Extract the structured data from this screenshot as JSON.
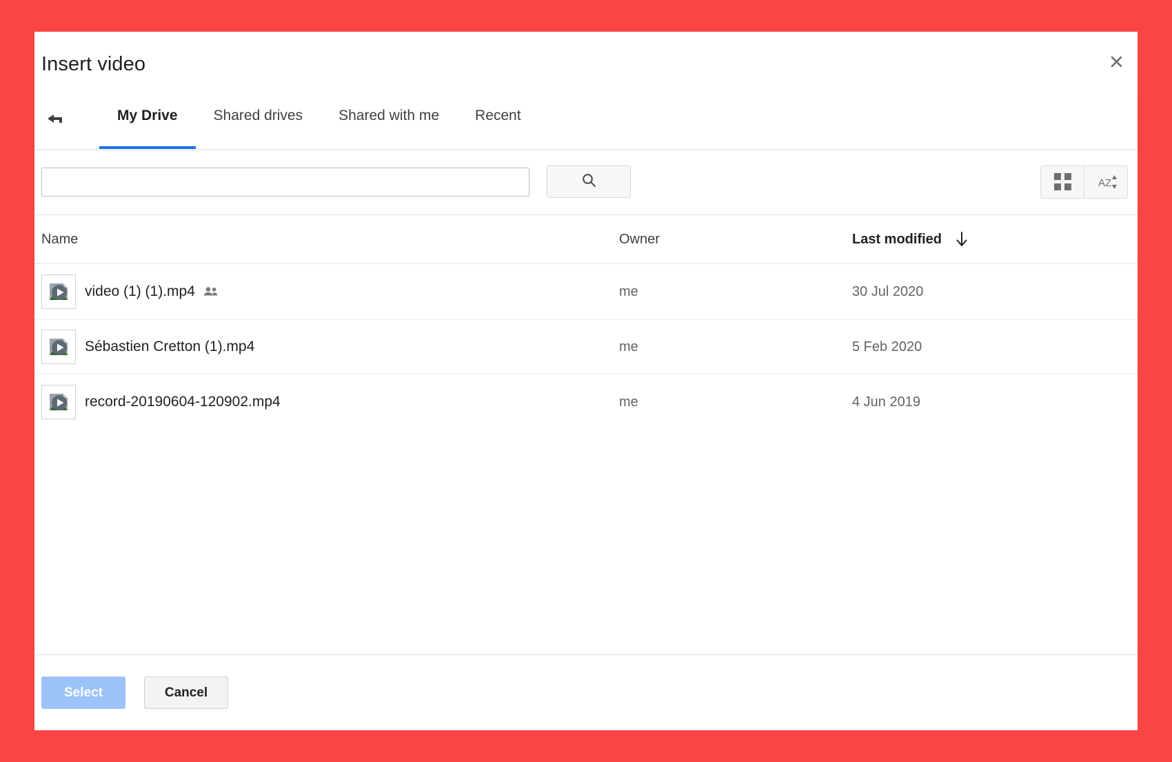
{
  "theme": {
    "page_background": "#fb4444",
    "dialog_background": "#ffffff",
    "accent_blue": "#1a73e8",
    "primary_button_bg": "#9cc2fa"
  },
  "dialog": {
    "title": "Insert video",
    "close_icon": "close-icon",
    "back_icon": "back-arrow-icon"
  },
  "tabs": [
    {
      "label": "My Drive",
      "active": true
    },
    {
      "label": "Shared drives",
      "active": false
    },
    {
      "label": "Shared with me",
      "active": false
    },
    {
      "label": "Recent",
      "active": false
    }
  ],
  "search": {
    "value": "",
    "placeholder": "",
    "button_icon": "search-icon"
  },
  "view_tools": [
    {
      "icon": "grid-view-icon"
    },
    {
      "icon": "sort-az-icon"
    }
  ],
  "list": {
    "columns": {
      "name": "Name",
      "owner": "Owner",
      "modified": "Last modified",
      "sort_direction_icon": "arrow-down-icon"
    },
    "rows": [
      {
        "icon": "video-file-icon",
        "name": "video (1) (1).mp4",
        "shared": true,
        "shared_icon": "people-shared-icon",
        "owner": "me",
        "modified": "30 Jul 2020",
        "hovered": false
      },
      {
        "icon": "video-file-icon",
        "name": "Sébastien Cretton (1).mp4",
        "shared": false,
        "shared_icon": "",
        "owner": "me",
        "modified": "5 Feb 2020",
        "hovered": true
      },
      {
        "icon": "video-file-icon",
        "name": "record-20190604-120902.mp4",
        "shared": false,
        "shared_icon": "",
        "owner": "me",
        "modified": "4 Jun 2019",
        "hovered": false
      }
    ]
  },
  "footer": {
    "select_label": "Select",
    "cancel_label": "Cancel"
  }
}
